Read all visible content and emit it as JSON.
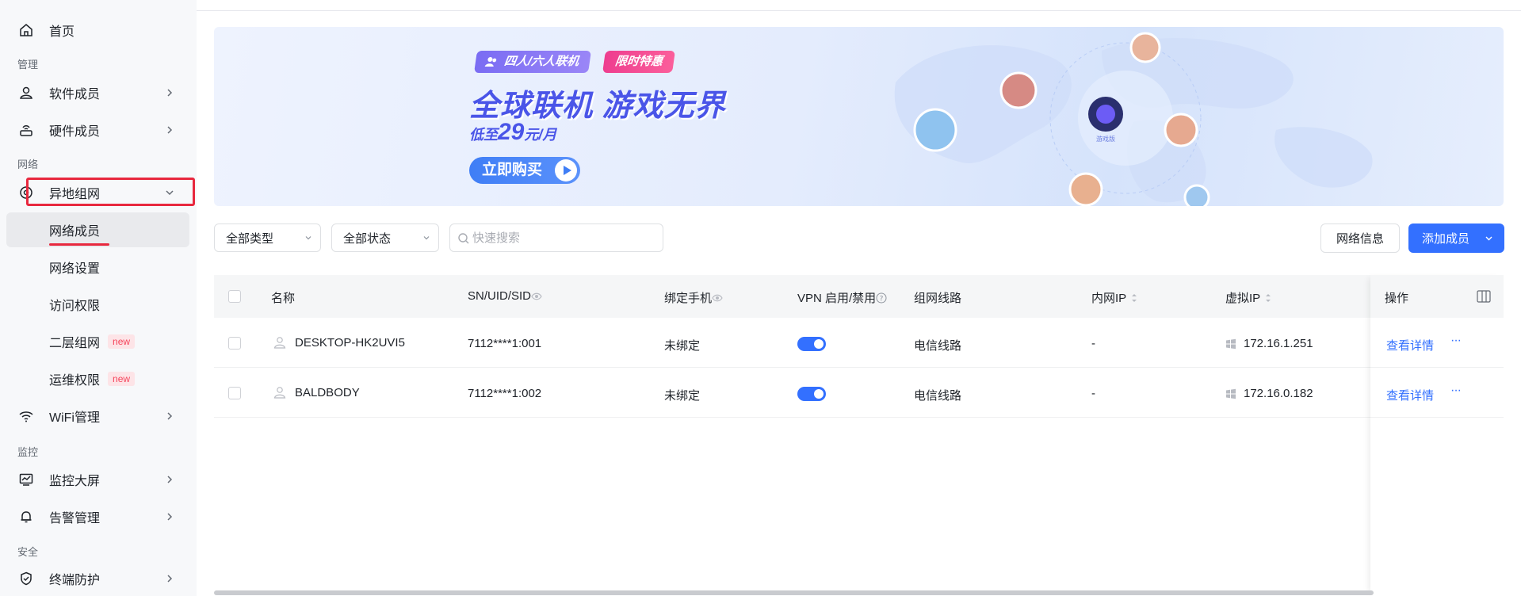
{
  "sidebar": {
    "home": "首页",
    "section_manage": "管理",
    "software_members": "软件成员",
    "hardware_members": "硬件成员",
    "section_network": "网络",
    "remote_network": "异地组网",
    "network_members": "网络成员",
    "network_settings": "网络设置",
    "access_rights": "访问权限",
    "layer2_network": "二层组网",
    "layer2_badge": "new",
    "ops_rights": "运维权限",
    "ops_badge": "new",
    "wifi": "WiFi管理",
    "section_monitor": "监控",
    "monitor_screen": "监控大屏",
    "alert_mgmt": "告警管理",
    "section_security": "安全",
    "endpoint_protect": "终端防护"
  },
  "banner": {
    "tag1": "四人/六人联机",
    "tag2": "限时特惠",
    "headline": "全球联机 游戏无界",
    "price_prefix": "低至",
    "price_value": "29",
    "price_suffix": "元/月",
    "buy": "立即购买",
    "app_caption": "游戏版"
  },
  "toolbar": {
    "type_filter": "全部类型",
    "status_filter": "全部状态",
    "search_placeholder": "快速搜索",
    "network_info": "网络信息",
    "add_member": "添加成员"
  },
  "table": {
    "headers": {
      "name": "名称",
      "sn": "SN/UID/SID",
      "phone": "绑定手机",
      "vpn": "VPN 启用/禁用",
      "route": "组网线路",
      "lan_ip": "内网IP",
      "virtual_ip": "虚拟IP",
      "ops": "操作"
    },
    "rows": [
      {
        "name": "DESKTOP-HK2UVI5",
        "sn": "7112****1:001",
        "phone": "未绑定",
        "vpn": true,
        "route": "电信线路",
        "lan_ip": "-",
        "virtual_ip": "172.16.1.251",
        "action": "查看详情",
        "more": "···"
      },
      {
        "name": "BALDBODY",
        "sn": "7112****1:002",
        "phone": "未绑定",
        "vpn": true,
        "route": "电信线路",
        "lan_ip": "-",
        "virtual_ip": "172.16.0.182",
        "action": "查看详情",
        "more": "···"
      }
    ]
  },
  "colors": {
    "primary": "#3370ff",
    "highlight_red": "#e8283e"
  }
}
